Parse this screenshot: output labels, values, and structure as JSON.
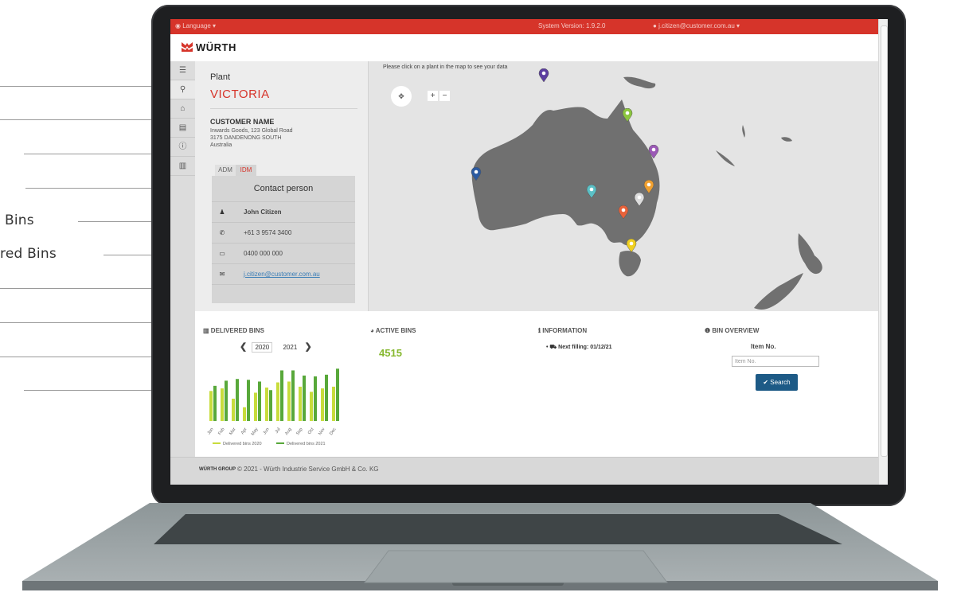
{
  "callouts": [
    "Bins",
    "red Bins"
  ],
  "topbar": {
    "language": "Language",
    "version": "System Version: 1.9.2.0",
    "user_email": "j.citizen@customer.com.au"
  },
  "brand": {
    "name": "WÜRTH",
    "color": "#d6342a"
  },
  "sidebar": {
    "icons": [
      "menu-icon",
      "search-icon",
      "home-icon",
      "document-icon",
      "info-icon",
      "chart-icon"
    ]
  },
  "plant": {
    "label": "Plant",
    "name": "VICTORIA",
    "customer_name": "CUSTOMER NAME",
    "address_lines": [
      "Inwards Goods, 123 Global Road",
      "3175 DANDENONG SOUTH",
      "Australia"
    ],
    "tabs": [
      "ADM",
      "IDM"
    ],
    "contact_title": "Contact person",
    "contact": {
      "name": "John Citizen",
      "phone": "+61 3 9574 3400",
      "mobile": "0400 000 000",
      "email": "j.citizen@customer.com.au"
    }
  },
  "map": {
    "hint": "Please click on a plant in the map to see your data",
    "zoom_in": "+",
    "zoom_out": "−",
    "pin_colors": [
      "#5d3fa0",
      "#8cc63f",
      "#9b59b6",
      "#2c5aa0",
      "#5bc0c6",
      "#f0a030",
      "#dddddd",
      "#e8623a",
      "#f0d020"
    ]
  },
  "delivered": {
    "title": "DELIVERED BINS",
    "years": [
      "2020",
      "2021"
    ],
    "legend": [
      "Delivered bins 2020",
      "Delivered bins 2021"
    ]
  },
  "active_bins": {
    "title": "ACTIVE BINS",
    "value": "4515"
  },
  "information": {
    "title": "INFORMATION",
    "next_filling": "Next filling: 01/12/21"
  },
  "bin_overview": {
    "title": "BIN OVERVIEW",
    "item_label": "Item No.",
    "placeholder": "Item No.",
    "search_label": "Search"
  },
  "footer": {
    "group_logo": "WÜRTH GROUP",
    "copyright": "© 2021 - Würth Industrie Service GmbH & Co. KG"
  },
  "chart_data": {
    "type": "bar",
    "categories": [
      "Jan",
      "Feb",
      "Mar",
      "Apr",
      "May",
      "Jun",
      "Jul",
      "Aug",
      "Sep",
      "Oct",
      "Nov",
      "Dec"
    ],
    "series": [
      {
        "name": "Delivered bins 2020",
        "values": [
          35,
          38,
          26,
          16,
          33,
          39,
          45,
          46,
          40,
          34,
          38,
          40
        ],
        "color": "#c8dc3c"
      },
      {
        "name": "Delivered bins 2021",
        "values": [
          41,
          47,
          49,
          48,
          46,
          36,
          59,
          59,
          53,
          52,
          54,
          61
        ],
        "color": "#58a83a"
      }
    ],
    "ylim": [
      0,
      65
    ]
  }
}
